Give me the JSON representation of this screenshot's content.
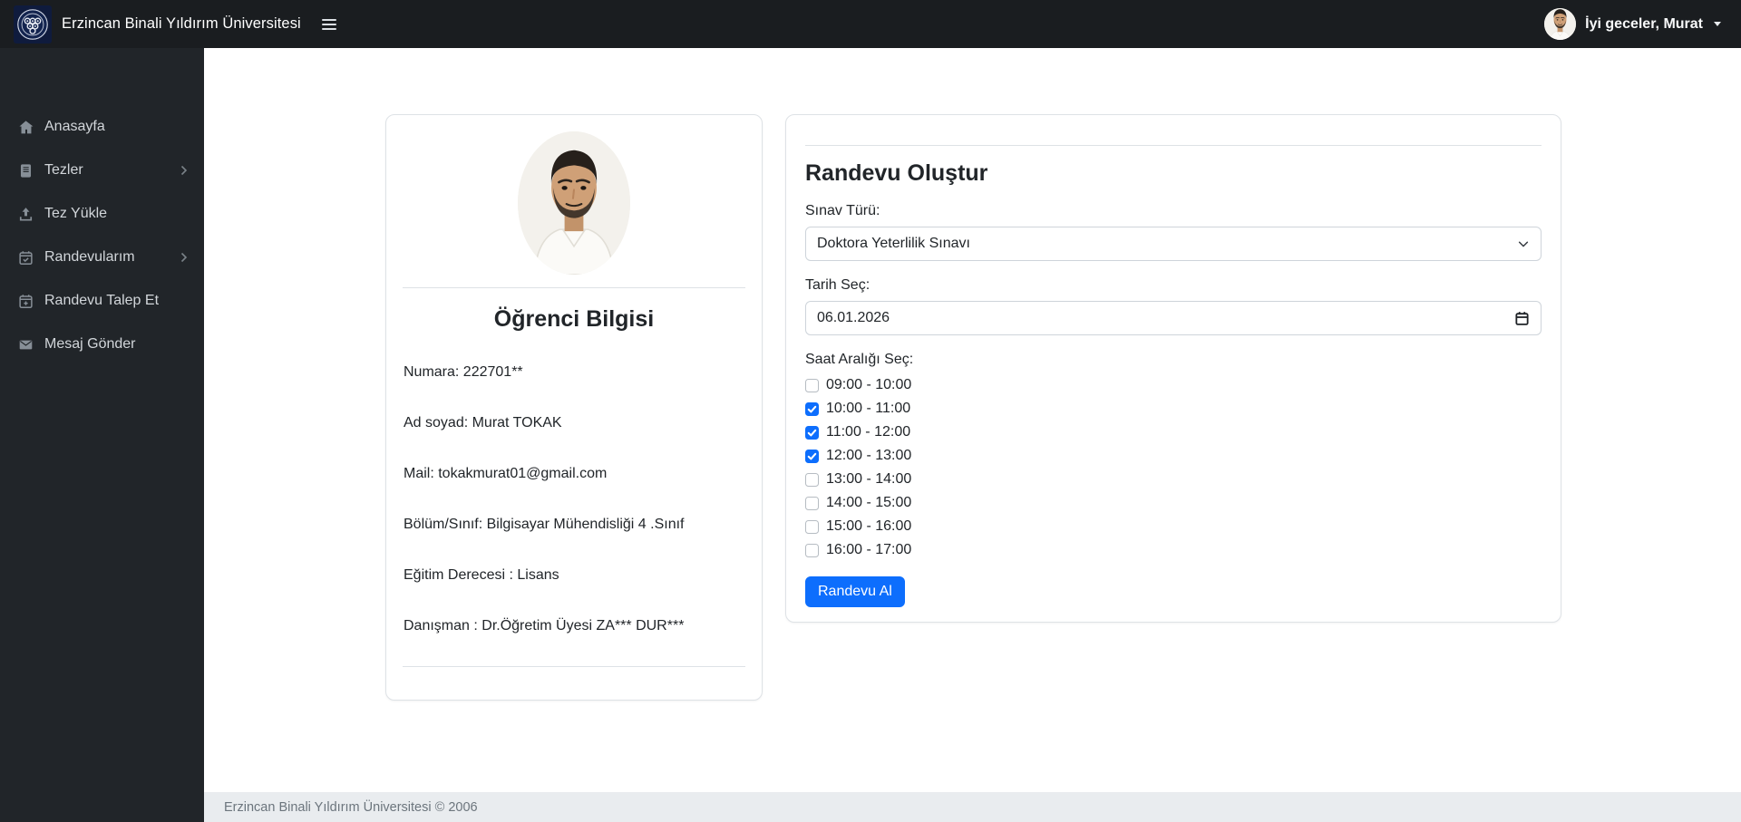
{
  "navbar": {
    "brand": "Erzincan Binali Yıldırım Üniversitesi",
    "hamburger_icon": "hamburger-icon",
    "user": {
      "greeting": "İyi geceler, Murat",
      "avatar_icon": "user-avatar",
      "caret_icon": "caret-down-icon"
    }
  },
  "sidebar": {
    "items": [
      {
        "label": "Anasayfa",
        "icon": "home-icon",
        "has_submenu": false
      },
      {
        "label": "Tezler",
        "icon": "book-icon",
        "has_submenu": true
      },
      {
        "label": "Tez Yükle",
        "icon": "upload-icon",
        "has_submenu": false
      },
      {
        "label": "Randevularım",
        "icon": "calendar-check-icon",
        "has_submenu": true
      },
      {
        "label": "Randevu Talep Et",
        "icon": "calendar-plus-icon",
        "has_submenu": false
      },
      {
        "label": "Mesaj Gönder",
        "icon": "envelope-icon",
        "has_submenu": false
      }
    ]
  },
  "student_card": {
    "title": "Öğrenci Bilgisi",
    "photo_icon": "student-photo",
    "fields": [
      "Numara: 222701**",
      "Ad soyad: Murat TOKAK",
      "Mail: tokakmurat01@gmail.com",
      "Bölüm/Sınıf: Bilgisayar Mühendisliği 4 .Sınıf",
      "Eğitim Derecesi : Lisans",
      "Danışman : Dr.Öğretim Üyesi ZA*** DUR***"
    ]
  },
  "appointment_form": {
    "title": "Randevu Oluştur",
    "exam_type": {
      "label": "Sınav Türü:",
      "value": "Doktora Yeterlilik Sınavı"
    },
    "date": {
      "label": "Tarih Seç:",
      "value": "06.01.2026"
    },
    "time": {
      "label": "Saat Aralığı Seç:",
      "slots": [
        {
          "label": "09:00 - 10:00",
          "checked": false
        },
        {
          "label": "10:00 - 11:00",
          "checked": true
        },
        {
          "label": "11:00 - 12:00",
          "checked": true
        },
        {
          "label": "12:00 - 13:00",
          "checked": true
        },
        {
          "label": "13:00 - 14:00",
          "checked": false
        },
        {
          "label": "14:00 - 15:00",
          "checked": false
        },
        {
          "label": "15:00 - 16:00",
          "checked": false
        },
        {
          "label": "16:00 - 17:00",
          "checked": false
        }
      ]
    },
    "submit_label": "Randevu Al"
  },
  "footer": {
    "text": "Erzincan Binali Yıldırım Üniversitesi © 2006"
  },
  "colors": {
    "primary": "#0d6efd",
    "navbar_bg": "#1a1d20",
    "sidebar_bg": "#212529",
    "footer_bg": "#e9ecef",
    "card_border": "#dee2e6",
    "text": "#212529"
  }
}
